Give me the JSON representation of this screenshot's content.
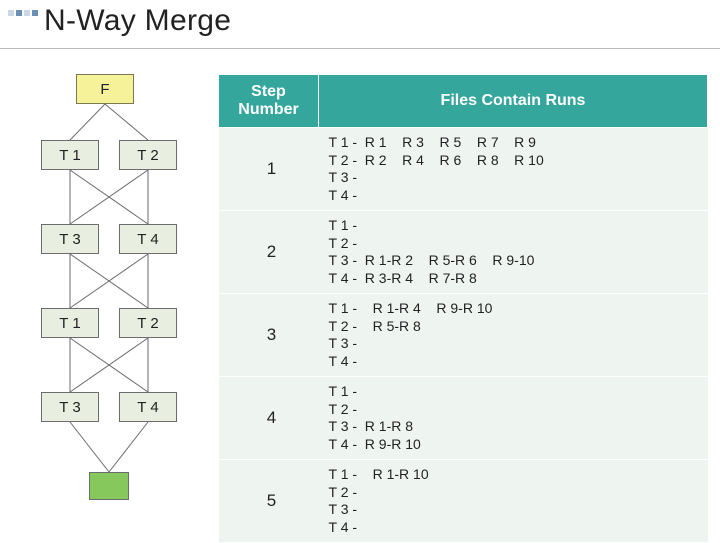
{
  "title": "N-Way Merge",
  "diagram": {
    "nodes": {
      "F": "F",
      "T1a": "T 1",
      "T2a": "T 2",
      "T3a": "T 3",
      "T4a": "T 4",
      "T1b": "T 1",
      "T2b": "T 2",
      "T3b": "T 3",
      "T4b": "T 4"
    }
  },
  "table": {
    "headers": {
      "step": "Step Number",
      "runs": "Files Contain Runs"
    },
    "rows": [
      {
        "step": "1",
        "runs": "T 1 -  R 1    R 3    R 5    R 7    R 9\nT 2 -  R 2    R 4    R 6    R 8    R 10\nT 3 -\nT 4 -"
      },
      {
        "step": "2",
        "runs": "T 1 -\nT 2 -\nT 3 -  R 1-R 2    R 5-R 6    R 9-10\nT 4 -  R 3-R 4    R 7-R 8"
      },
      {
        "step": "3",
        "runs": "T 1 -    R 1-R 4    R 9-R 10\nT 2 -    R 5-R 8\nT 3 -\nT 4 -"
      },
      {
        "step": "4",
        "runs": "T 1 -\nT 2 -\nT 3 -  R 1-R 8\nT 4 -  R 9-R 10"
      },
      {
        "step": "5",
        "runs": "T 1 -    R 1-R 10\nT 2 -\nT 3 -\nT 4 -"
      }
    ]
  }
}
